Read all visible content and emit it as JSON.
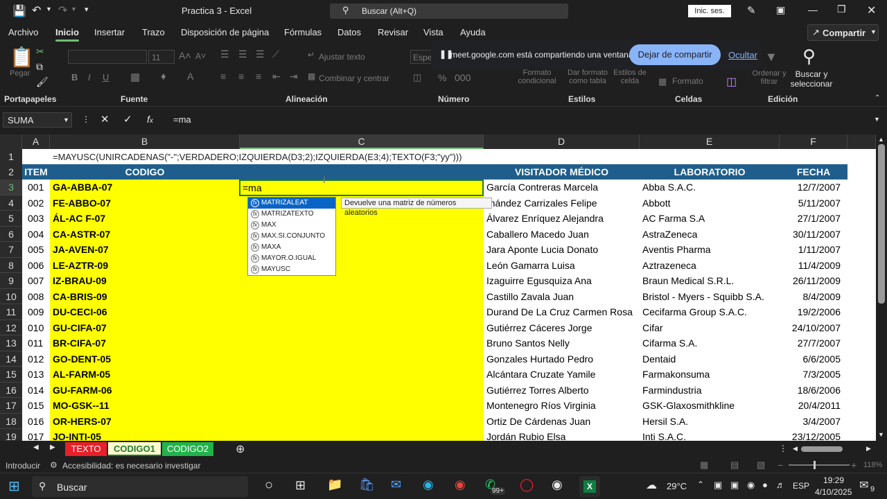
{
  "titlebar": {
    "title": "Practica 3  -  Excel",
    "search_placeholder": "Buscar (Alt+Q)",
    "signin_label": "Inic. ses."
  },
  "menu": [
    "Archivo",
    "Inicio",
    "Insertar",
    "Trazo",
    "Disposición de página",
    "Fórmulas",
    "Datos",
    "Revisar",
    "Vista",
    "Ayuda"
  ],
  "share_label": "Compartir",
  "ribbon": {
    "paste_label": "Pegar",
    "font_size": "11",
    "wrap_label": "Ajustar texto",
    "merge_label": "Combinar y centrar",
    "format_label": "Formato",
    "number_format": "Espe",
    "styles": [
      "Formato condicional",
      "Dar formato como tabla",
      "Estilos de celda"
    ],
    "sort_label": "Ordenar y filtrar",
    "find_label": "Buscar y seleccionar",
    "groups": [
      "Portapapeles",
      "Fuente",
      "Alineación",
      "Número",
      "Estilos",
      "Celdas",
      "Edición"
    ]
  },
  "share_banner": {
    "text": "meet.google.com está compartiendo una ventana.",
    "stop_label": "Dejar de compartir",
    "hide_label": "Ocultar"
  },
  "formula_bar": {
    "name_box": "SUMA",
    "content": "=ma"
  },
  "columns": [
    "A",
    "B",
    "C",
    "D",
    "E",
    "F"
  ],
  "row1_formula": "=MAYUSC(UNIRCADENAS(\"-\";VERDADERO;IZQUIERDA(D3;2);IZQUIERDA(E3;4);TEXTO(F3;\"yy\")))",
  "headers": {
    "item": "ITEM",
    "codigo": "CODIGO",
    "visitador": "VISITADOR MÉDICO",
    "laboratorio": "LABORATORIO",
    "fecha": "FECHA"
  },
  "active_cell_text": "=ma",
  "rows": [
    {
      "n": "3",
      "item": "001",
      "codigo": "GA-ABBA-07",
      "visitador": "García Contreras Marcela",
      "lab": "Abba S.A.C.",
      "fecha": "12/7/2007"
    },
    {
      "n": "4",
      "item": "002",
      "codigo": "FE-ABBO-07",
      "visitador": "rnández Carrizales Felipe",
      "lab": "Abbott",
      "fecha": "5/11/2007"
    },
    {
      "n": "5",
      "item": "003",
      "codigo": "ÁL-AC F-07",
      "visitador": "Álvarez Enríquez Alejandra",
      "lab": "AC Farma S.A",
      "fecha": "27/1/2007"
    },
    {
      "n": "6",
      "item": "004",
      "codigo": "CA-ASTR-07",
      "visitador": "Caballero Macedo Juan",
      "lab": "AstraZeneca",
      "fecha": "30/11/2007"
    },
    {
      "n": "7",
      "item": "005",
      "codigo": "JA-AVEN-07",
      "visitador": "Jara Aponte Lucia Donato",
      "lab": "Aventis Pharma",
      "fecha": "1/11/2007"
    },
    {
      "n": "8",
      "item": "006",
      "codigo": "LE-AZTR-09",
      "visitador": "León Gamarra Luisa",
      "lab": "Aztrazeneca",
      "fecha": "11/4/2009"
    },
    {
      "n": "9",
      "item": "007",
      "codigo": "IZ-BRAU-09",
      "visitador": "Izaguirre Egusquiza Ana",
      "lab": "Braun Medical S.R.L.",
      "fecha": "26/11/2009"
    },
    {
      "n": "10",
      "item": "008",
      "codigo": "CA-BRIS-09",
      "visitador": "Castillo Zavala Juan",
      "lab": "Bristol - Myers - Squibb S.A.",
      "fecha": "8/4/2009"
    },
    {
      "n": "11",
      "item": "009",
      "codigo": "DU-CECI-06",
      "visitador": "Durand De La Cruz Carmen Rosa",
      "lab": "Cecifarma Group S.A.C.",
      "fecha": "19/2/2006"
    },
    {
      "n": "12",
      "item": "010",
      "codigo": "GU-CIFA-07",
      "visitador": "Gutiérrez Cáceres Jorge",
      "lab": "Cifar",
      "fecha": "24/10/2007"
    },
    {
      "n": "13",
      "item": "011",
      "codigo": "BR-CIFA-07",
      "visitador": "Bruno Santos Nelly",
      "lab": "Cifarma S.A.",
      "fecha": "27/7/2007"
    },
    {
      "n": "14",
      "item": "012",
      "codigo": "GO-DENT-05",
      "visitador": "Gonzales Hurtado Pedro",
      "lab": "Dentaid",
      "fecha": "6/6/2005"
    },
    {
      "n": "15",
      "item": "013",
      "codigo": "AL-FARM-05",
      "visitador": "Alcántara Cruzate Yamile",
      "lab": "Farmakonsuma",
      "fecha": "7/3/2005"
    },
    {
      "n": "16",
      "item": "014",
      "codigo": "GU-FARM-06",
      "visitador": "Gutiérrez Torres Alberto",
      "lab": "Farmindustria",
      "fecha": "18/6/2006"
    },
    {
      "n": "17",
      "item": "015",
      "codigo": "MO-GSK--11",
      "visitador": "Montenegro Ríos Virginia",
      "lab": "GSK-Glaxosmithkline",
      "fecha": "20/4/2011"
    },
    {
      "n": "18",
      "item": "016",
      "codigo": "OR-HERS-07",
      "visitador": "Ortiz De Cárdenas Juan",
      "lab": "Hersil S.A.",
      "fecha": "3/4/2007"
    },
    {
      "n": "19",
      "item": "017",
      "codigo": "JO-INTI-05",
      "visitador": "Jordán Rubio Elsa",
      "lab": "Inti S.A.C.",
      "fecha": "23/12/2005"
    }
  ],
  "autocomplete": {
    "items": [
      "MATRIZALEAT",
      "MATRIZATEXTO",
      "MAX",
      "MAX.SI.CONJUNTO",
      "MAXA",
      "MAYOR.O.IGUAL",
      "MAYUSC"
    ],
    "tooltip": "Devuelve una matriz de números aleatorios"
  },
  "sheets": [
    {
      "label": "TEXTO",
      "bg": "#e8202a",
      "fg": "#ffffff"
    },
    {
      "label": "CODIGO1",
      "bg": "#fffbd0",
      "fg": "#1f7a2e"
    },
    {
      "label": "CODIGO2",
      "bg": "#22b34a",
      "fg": "#ffffff"
    }
  ],
  "status": {
    "mode": "Introducir",
    "accessibility": "Accesibilidad: es necesario investigar",
    "zoom": "118%"
  },
  "taskbar": {
    "search_placeholder": "Buscar",
    "badge": "99+",
    "temperature": "29°C",
    "lang": "ESP",
    "time": "19:29",
    "date": "4/10/2025",
    "notif_count": "9"
  },
  "colors": {
    "accent": "#6fbf73",
    "header_blue": "#1f5e8c",
    "highlight_yellow": "#ffff00"
  }
}
